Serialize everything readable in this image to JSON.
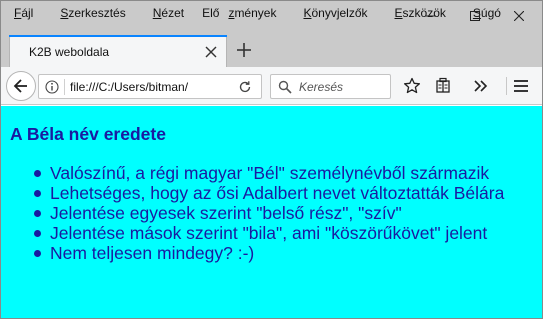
{
  "menubar": {
    "items": [
      {
        "pre": "",
        "key": "F",
        "post": "ájl"
      },
      {
        "pre": "",
        "key": "S",
        "post": "zerkesztés"
      },
      {
        "pre": "",
        "key": "N",
        "post": "ézet"
      },
      {
        "pre": "Elő",
        "key": "z",
        "post": "mények"
      },
      {
        "pre": "",
        "key": "K",
        "post": "önyvjelzők"
      },
      {
        "pre": "",
        "key": "E",
        "post": "szközök"
      },
      {
        "pre": "",
        "key": "S",
        "post": "úgó"
      }
    ]
  },
  "tab": {
    "title": "K2B weboldala"
  },
  "navbar": {
    "url": "file:///C:/Users/bitman/",
    "search_placeholder": "Keresés"
  },
  "page": {
    "heading": "A Béla név eredete",
    "items": [
      "Valószínű, a régi magyar \"Bél\" személynévből származik",
      "Lehetséges, hogy az ősi Adalbert nevet változtatták Bélára",
      "Jelentése egyesek szerint \"belső rész\", \"szív\"",
      "Jelentése mások szerint \"bila\", ami \"köszörűkövet\" jelent",
      "Nem teljesen mindegy? :-)"
    ]
  },
  "icons": {
    "minimize": "minimize-icon",
    "maximize": "maximize-icon",
    "close": "close-icon",
    "back": "back-arrow-icon",
    "info": "info-icon",
    "reload": "reload-icon",
    "search": "search-icon",
    "bookmark": "bookmark-star-icon",
    "reader": "reader-view-icon",
    "overflow": "overflow-chevron-icon",
    "menu": "hamburger-menu-icon"
  },
  "colors": {
    "chrome": "#cacaca",
    "toolbar": "#f5f6f7",
    "tab_accent": "#0a84ff",
    "page_background": "#00ffff",
    "page_text": "#1a1aa0"
  }
}
